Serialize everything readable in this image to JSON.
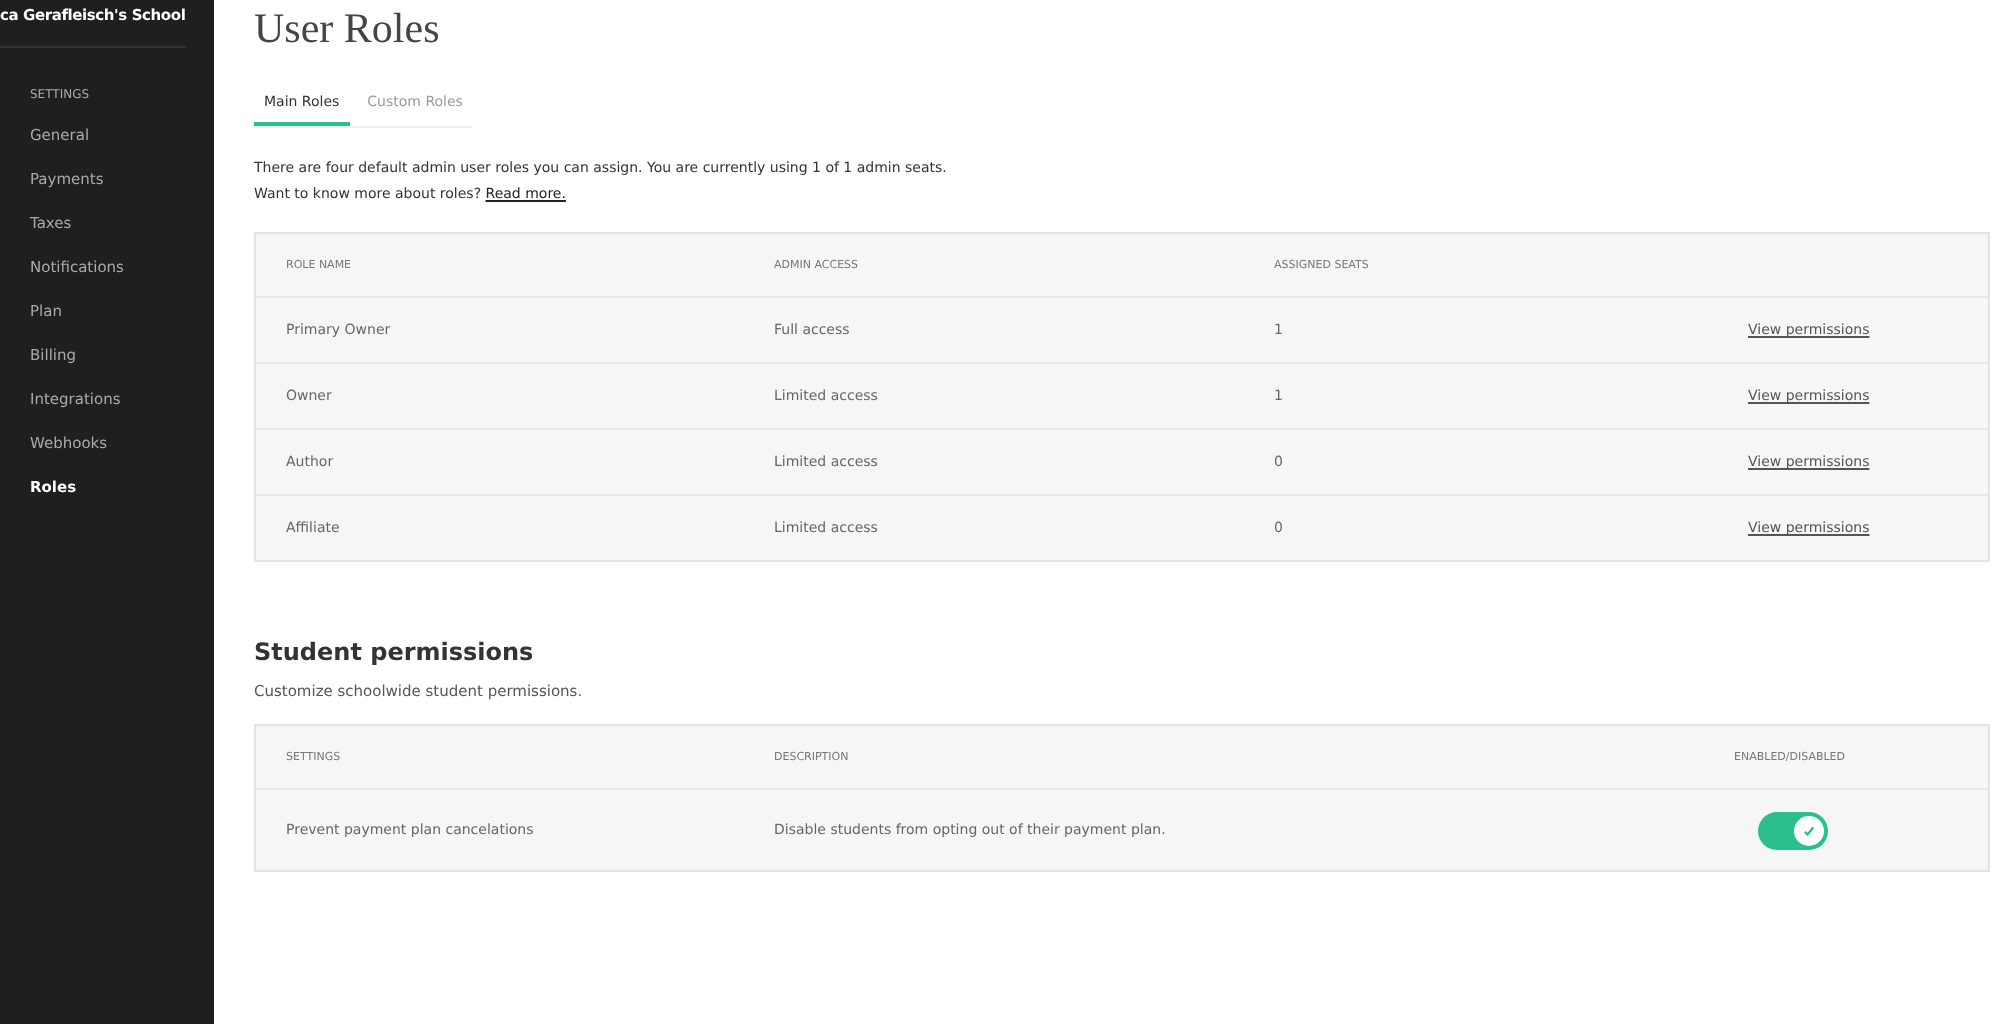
{
  "sidebar": {
    "school_name": "ca Gerafleisch's School",
    "section": "SETTINGS",
    "items": [
      {
        "label": "General",
        "selected": false
      },
      {
        "label": "Payments",
        "selected": false
      },
      {
        "label": "Taxes",
        "selected": false
      },
      {
        "label": "Notifications",
        "selected": false
      },
      {
        "label": "Plan",
        "selected": false
      },
      {
        "label": "Billing",
        "selected": false
      },
      {
        "label": "Integrations",
        "selected": false
      },
      {
        "label": "Webhooks",
        "selected": false
      },
      {
        "label": "Roles",
        "selected": true
      }
    ]
  },
  "page_title": "User Roles",
  "tabs": [
    {
      "label": "Main Roles",
      "selected": true
    },
    {
      "label": "Custom Roles",
      "selected": false
    }
  ],
  "intro": {
    "text": "There are four default admin user roles you can assign. You are currently using 1 of 1 admin seats. Want to know more about roles?",
    "link": "Read more."
  },
  "roles_table": {
    "columns": [
      "ROLE NAME",
      "ADMIN ACCESS",
      "ASSIGNED SEATS"
    ],
    "rows": [
      {
        "name": "Primary Owner",
        "access": "Full access",
        "seats": "1",
        "link": "View permissions"
      },
      {
        "name": "Owner",
        "access": "Limited access",
        "seats": "1",
        "link": "View permissions"
      },
      {
        "name": "Author",
        "access": "Limited access",
        "seats": "0",
        "link": "View permissions"
      },
      {
        "name": "Affiliate",
        "access": "Limited access",
        "seats": "0",
        "link": "View permissions"
      }
    ]
  },
  "student_permissions": {
    "title": "Student permissions",
    "subtitle": "Customize schoolwide student permissions.",
    "columns": [
      "SETTINGS",
      "DESCRIPTION",
      "ENABLED/DISABLED"
    ],
    "rows": [
      {
        "setting": "Prevent payment plan cancelations",
        "description": "Disable students from opting out of their payment plan.",
        "on": true
      }
    ]
  }
}
